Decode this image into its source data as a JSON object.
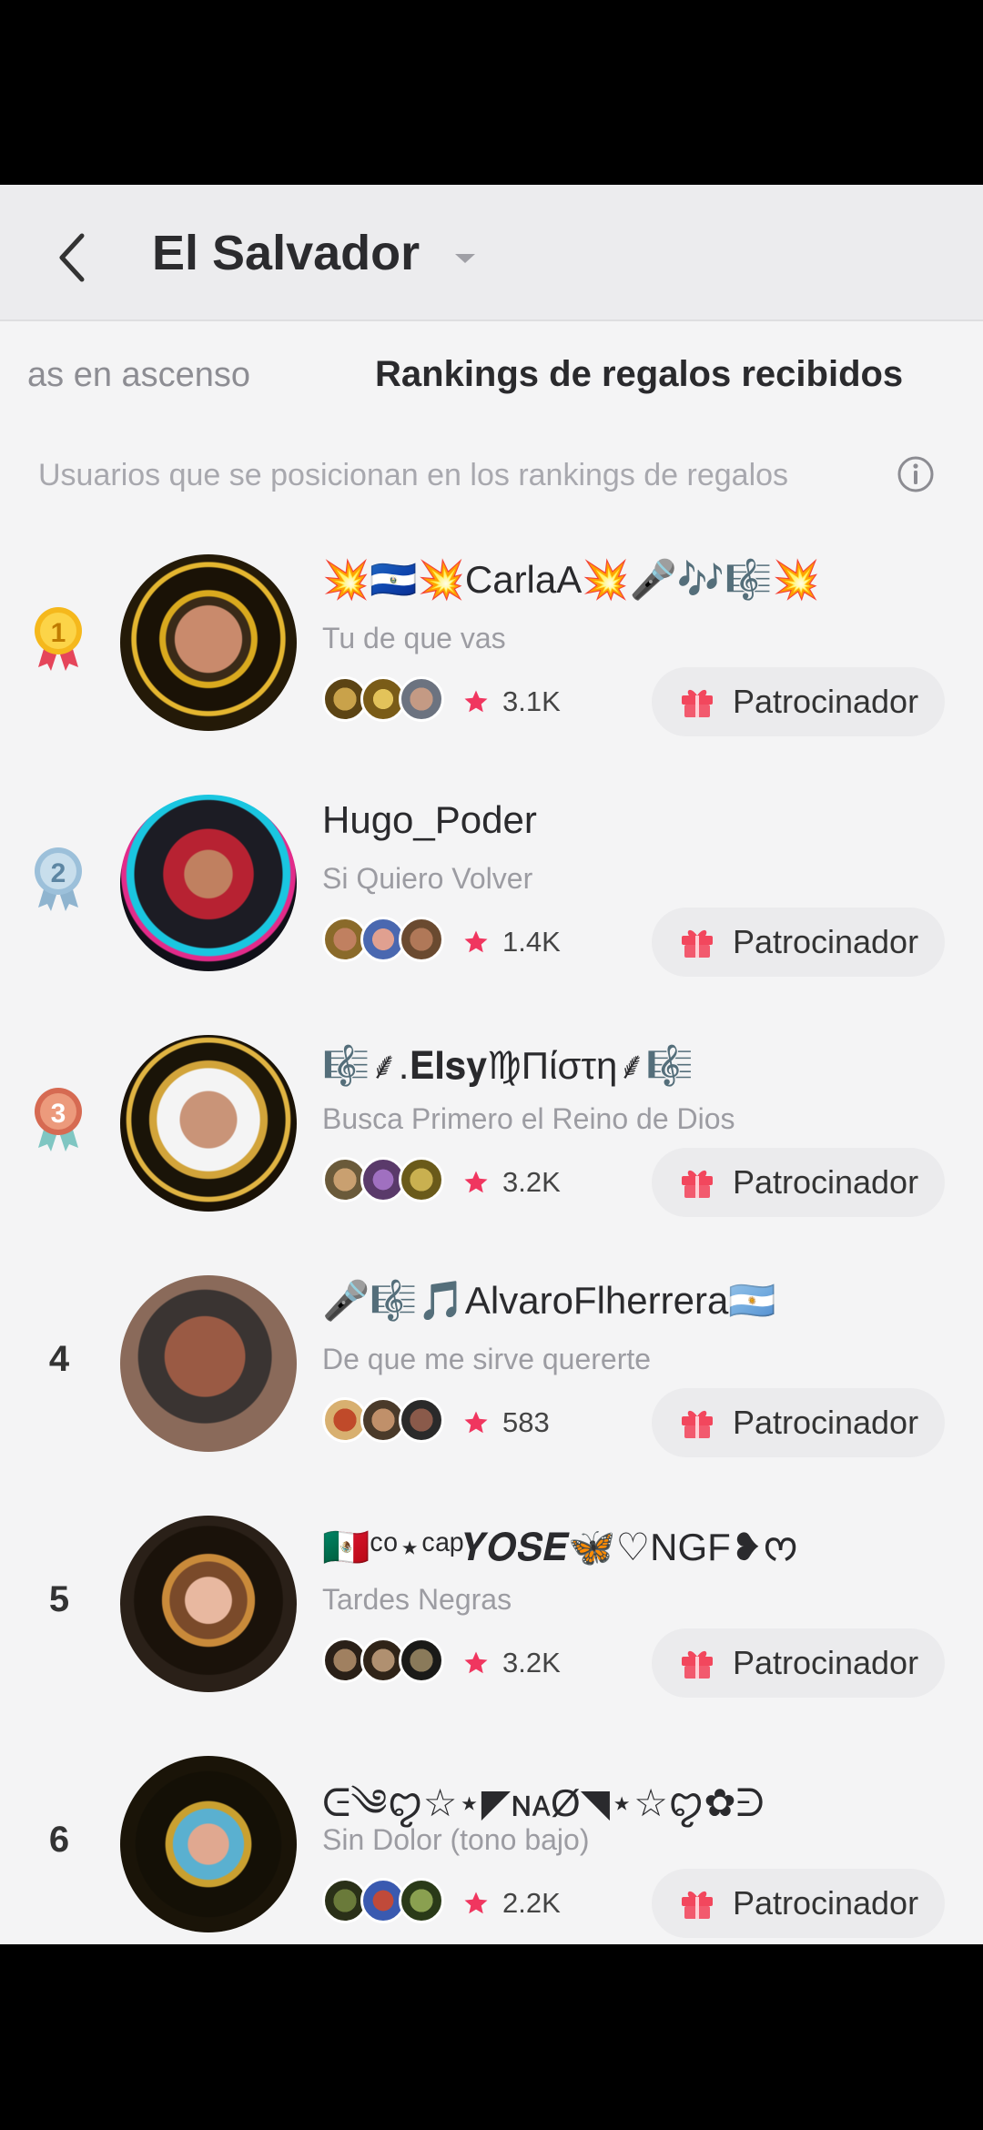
{
  "header": {
    "title": "El Salvador",
    "back_icon": "chevron-left-icon",
    "dropdown_icon": "caret-down-icon"
  },
  "tabs": [
    {
      "label": "as en ascenso",
      "active": false
    },
    {
      "label": "Rankings de regalos recibidos",
      "active": true
    }
  ],
  "subtitle": "Usuarios que se posicionan en los rankings de regalos",
  "colors": {
    "accent_star": "#f0365f",
    "gift_red": "#f2475d",
    "medal_gold": "#f5b81c",
    "medal_silver": "#8fb4cf",
    "medal_bronze": "#d66a52"
  },
  "rankings": [
    {
      "rank": "1",
      "medal": "gold",
      "name": "💥🇸🇻💥CarlaA💥🎤🎶🎼💥",
      "song": "Tu de que vas",
      "stars": "3.1K",
      "sponsor_label": "Patrocinador"
    },
    {
      "rank": "2",
      "medal": "silver",
      "name": "Hugo_Poder",
      "song": "Si Quiero Volver",
      "stars": "1.4K",
      "sponsor_label": "Patrocinador"
    },
    {
      "rank": "3",
      "medal": "bronze",
      "name": "🎼⸙.𝐄𝐥𝐬𝐲♍Πίστη⸙🎼",
      "song": "Busca Primero el Reino de Dios",
      "stars": "3.2K",
      "sponsor_label": "Patrocinador"
    },
    {
      "rank": "4",
      "medal": "",
      "name": "🎤🎼🎵AlvaroFlherrera🇦🇷",
      "song": "De que me sirve quererte",
      "stars": "583",
      "sponsor_label": "Patrocinador"
    },
    {
      "rank": "5",
      "medal": "",
      "name": "🇲🇽ᶜᵒ⋆ᶜᵃᵖ𝒀𝑶𝑺𝑬🦋♡NGF❥ᰔ",
      "song": "Tardes Negras",
      "stars": "3.2K",
      "sponsor_label": "Patrocinador"
    },
    {
      "rank": "6",
      "medal": "",
      "name": "ᕮ༄ꨄ☆⋆◤ɴᴀØ◥⋆☆ꨄ✿ᕭ",
      "song": "Sin Dolor (tono bajo)",
      "stars": "2.2K",
      "sponsor_label": "Patrocinador"
    }
  ]
}
